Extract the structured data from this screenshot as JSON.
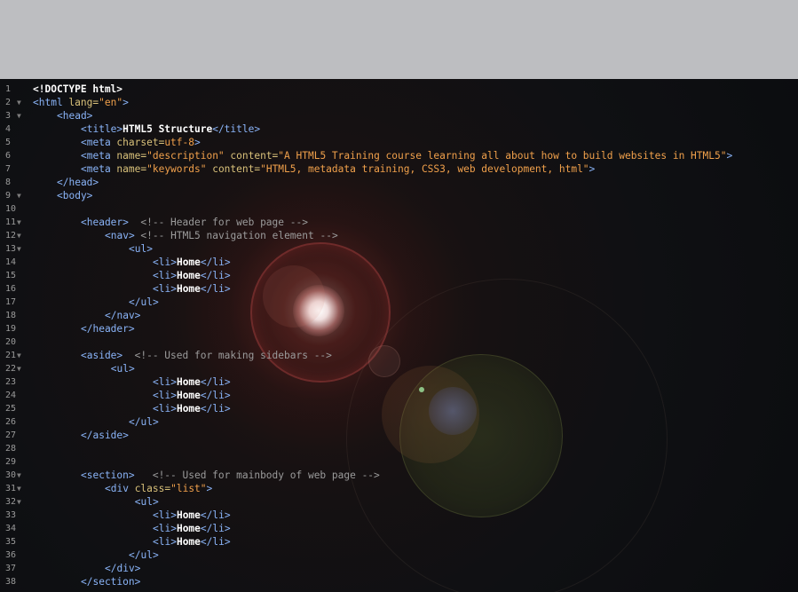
{
  "code_lines": [
    {
      "n": "1",
      "fold": "",
      "indent": 0,
      "parts": [
        {
          "t": "doc",
          "s": "<!DOCTYPE html>"
        }
      ]
    },
    {
      "n": "2",
      "fold": "▼",
      "indent": 0,
      "parts": [
        {
          "t": "tag",
          "s": "<html "
        },
        {
          "t": "attr",
          "s": "lang="
        },
        {
          "t": "val",
          "s": "\"en\""
        },
        {
          "t": "tag",
          "s": ">"
        }
      ]
    },
    {
      "n": "3",
      "fold": "▼",
      "indent": 4,
      "parts": [
        {
          "t": "tag",
          "s": "<head>"
        }
      ]
    },
    {
      "n": "4",
      "fold": "",
      "indent": 8,
      "parts": [
        {
          "t": "tag",
          "s": "<title>"
        },
        {
          "t": "txt",
          "s": "HTML5 Structure"
        },
        {
          "t": "tag",
          "s": "</title>"
        }
      ]
    },
    {
      "n": "5",
      "fold": "",
      "indent": 8,
      "parts": [
        {
          "t": "tag",
          "s": "<meta "
        },
        {
          "t": "attr",
          "s": "charset="
        },
        {
          "t": "val",
          "s": "utf-8"
        },
        {
          "t": "tag",
          "s": ">"
        }
      ]
    },
    {
      "n": "6",
      "fold": "",
      "indent": 8,
      "parts": [
        {
          "t": "tag",
          "s": "<meta "
        },
        {
          "t": "attr",
          "s": "name="
        },
        {
          "t": "val",
          "s": "\"description\""
        },
        {
          "t": "attr",
          "s": " content="
        },
        {
          "t": "val",
          "s": "\"A HTML5 Training course learning all about how to build websites in HTML5\""
        },
        {
          "t": "tag",
          "s": ">"
        }
      ]
    },
    {
      "n": "7",
      "fold": "",
      "indent": 8,
      "parts": [
        {
          "t": "tag",
          "s": "<meta "
        },
        {
          "t": "attr",
          "s": "name="
        },
        {
          "t": "val",
          "s": "\"keywords\""
        },
        {
          "t": "attr",
          "s": " content="
        },
        {
          "t": "val",
          "s": "\"HTML5, metadata training, CSS3, web development, html\""
        },
        {
          "t": "tag",
          "s": ">"
        }
      ]
    },
    {
      "n": "8",
      "fold": "",
      "indent": 4,
      "parts": [
        {
          "t": "tag",
          "s": "</head>"
        }
      ]
    },
    {
      "n": "9",
      "fold": "▼",
      "indent": 4,
      "parts": [
        {
          "t": "tag",
          "s": "<body>"
        }
      ]
    },
    {
      "n": "10",
      "fold": "",
      "indent": 0,
      "parts": []
    },
    {
      "n": "11",
      "fold": "▼",
      "indent": 8,
      "parts": [
        {
          "t": "tag",
          "s": "<header>"
        },
        {
          "t": "cmt",
          "s": "  <!-- Header for web page -->"
        }
      ]
    },
    {
      "n": "12",
      "fold": "▼",
      "indent": 12,
      "parts": [
        {
          "t": "tag",
          "s": "<nav>"
        },
        {
          "t": "cmt",
          "s": " <!-- HTML5 navigation element -->"
        }
      ]
    },
    {
      "n": "13",
      "fold": "▼",
      "indent": 16,
      "parts": [
        {
          "t": "tag",
          "s": "<ul>"
        }
      ]
    },
    {
      "n": "14",
      "fold": "",
      "indent": 20,
      "parts": [
        {
          "t": "tag",
          "s": "<li>"
        },
        {
          "t": "txt",
          "s": "Home"
        },
        {
          "t": "tag",
          "s": "</li>"
        }
      ]
    },
    {
      "n": "15",
      "fold": "",
      "indent": 20,
      "parts": [
        {
          "t": "tag",
          "s": "<li>"
        },
        {
          "t": "txt",
          "s": "Home"
        },
        {
          "t": "tag",
          "s": "</li>"
        }
      ]
    },
    {
      "n": "16",
      "fold": "",
      "indent": 20,
      "parts": [
        {
          "t": "tag",
          "s": "<li>"
        },
        {
          "t": "txt",
          "s": "Home"
        },
        {
          "t": "tag",
          "s": "</li>"
        }
      ]
    },
    {
      "n": "17",
      "fold": "",
      "indent": 16,
      "parts": [
        {
          "t": "tag",
          "s": "</ul>"
        }
      ]
    },
    {
      "n": "18",
      "fold": "",
      "indent": 12,
      "parts": [
        {
          "t": "tag",
          "s": "</nav>"
        }
      ]
    },
    {
      "n": "19",
      "fold": "",
      "indent": 8,
      "parts": [
        {
          "t": "tag",
          "s": "</header>"
        }
      ]
    },
    {
      "n": "20",
      "fold": "",
      "indent": 0,
      "parts": []
    },
    {
      "n": "21",
      "fold": "▼",
      "indent": 8,
      "parts": [
        {
          "t": "tag",
          "s": "<aside>"
        },
        {
          "t": "cmt",
          "s": "  <!-- Used for making sidebars -->"
        }
      ]
    },
    {
      "n": "22",
      "fold": "▼",
      "indent": 13,
      "parts": [
        {
          "t": "tag",
          "s": "<ul>"
        }
      ]
    },
    {
      "n": "23",
      "fold": "",
      "indent": 20,
      "parts": [
        {
          "t": "tag",
          "s": "<li>"
        },
        {
          "t": "txt",
          "s": "Home"
        },
        {
          "t": "tag",
          "s": "</li>"
        }
      ]
    },
    {
      "n": "24",
      "fold": "",
      "indent": 20,
      "parts": [
        {
          "t": "tag",
          "s": "<li>"
        },
        {
          "t": "txt",
          "s": "Home"
        },
        {
          "t": "tag",
          "s": "</li>"
        }
      ]
    },
    {
      "n": "25",
      "fold": "",
      "indent": 20,
      "parts": [
        {
          "t": "tag",
          "s": "<li>"
        },
        {
          "t": "txt",
          "s": "Home"
        },
        {
          "t": "tag",
          "s": "</li>"
        }
      ]
    },
    {
      "n": "26",
      "fold": "",
      "indent": 16,
      "parts": [
        {
          "t": "tag",
          "s": "</ul>"
        }
      ]
    },
    {
      "n": "27",
      "fold": "",
      "indent": 8,
      "parts": [
        {
          "t": "tag",
          "s": "</aside>"
        }
      ]
    },
    {
      "n": "28",
      "fold": "",
      "indent": 0,
      "parts": []
    },
    {
      "n": "29",
      "fold": "",
      "indent": 0,
      "parts": []
    },
    {
      "n": "30",
      "fold": "▼",
      "indent": 8,
      "parts": [
        {
          "t": "tag",
          "s": "<section>"
        },
        {
          "t": "cmt",
          "s": "   <!-- Used for mainbody of web page -->"
        }
      ]
    },
    {
      "n": "31",
      "fold": "▼",
      "indent": 12,
      "parts": [
        {
          "t": "tag",
          "s": "<div "
        },
        {
          "t": "attr",
          "s": "class="
        },
        {
          "t": "val",
          "s": "\"list\""
        },
        {
          "t": "tag",
          "s": ">"
        }
      ]
    },
    {
      "n": "32",
      "fold": "▼",
      "indent": 17,
      "parts": [
        {
          "t": "tag",
          "s": "<ul>"
        }
      ]
    },
    {
      "n": "33",
      "fold": "",
      "indent": 20,
      "parts": [
        {
          "t": "tag",
          "s": "<li>"
        },
        {
          "t": "txt",
          "s": "Home"
        },
        {
          "t": "tag",
          "s": "</li>"
        }
      ]
    },
    {
      "n": "34",
      "fold": "",
      "indent": 20,
      "parts": [
        {
          "t": "tag",
          "s": "<li>"
        },
        {
          "t": "txt",
          "s": "Home"
        },
        {
          "t": "tag",
          "s": "</li>"
        }
      ]
    },
    {
      "n": "35",
      "fold": "",
      "indent": 20,
      "parts": [
        {
          "t": "tag",
          "s": "<li>"
        },
        {
          "t": "txt",
          "s": "Home"
        },
        {
          "t": "tag",
          "s": "</li>"
        }
      ]
    },
    {
      "n": "36",
      "fold": "",
      "indent": 16,
      "parts": [
        {
          "t": "tag",
          "s": "</ul>"
        }
      ]
    },
    {
      "n": "37",
      "fold": "",
      "indent": 12,
      "parts": [
        {
          "t": "tag",
          "s": "</div>"
        }
      ]
    },
    {
      "n": "38",
      "fold": "",
      "indent": 8,
      "parts": [
        {
          "t": "tag",
          "s": "</section>"
        }
      ]
    }
  ],
  "colors": {
    "tag": "#8ab4f8",
    "attr": "#d9c17a",
    "value": "#f0a04b",
    "text": "#ffffff",
    "comment": "#9b9b9b",
    "gutter": "#9a9a9a",
    "top_bar": "#bdbec1",
    "editor_bg": "#0c0d10"
  }
}
